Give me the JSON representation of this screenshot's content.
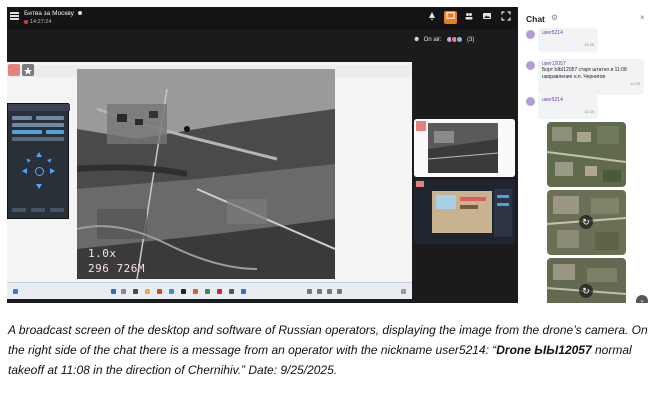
{
  "stream": {
    "title": "Битва за Москву",
    "time": "14:27:24",
    "on_air_label": "On air:",
    "on_air_count": "(3)"
  },
  "toolbar": {
    "icons": [
      "alert-icon",
      "broadcast-icon",
      "people-icon",
      "image-icon",
      "fullscreen-icon"
    ]
  },
  "video_overlay": {
    "zoom": "1.0x",
    "distance": "296 726M"
  },
  "chat": {
    "title": "Chat",
    "messages": [
      {
        "user": "user5214",
        "text": "",
        "time": "11:39"
      },
      {
        "user": "user12057",
        "text": "Борт ЫЫ12057 старт штатно в 11:08 направление н.п. Чернигов",
        "time": "11:39"
      },
      {
        "user": "user5214",
        "text": "",
        "time": "11:39"
      }
    ]
  },
  "caption": {
    "part1": "A broadcast screen of the desktop and software of Russian operators, displaying the image from the drone’s camera. On the right side of the chat there is a message from an operator with the nickname user5214: “",
    "bold": "Drone ЫЫ12057",
    "part2": " normal takeoff at 11:08 in the direction of Chernihiv.” Date: 9/25/2025."
  }
}
